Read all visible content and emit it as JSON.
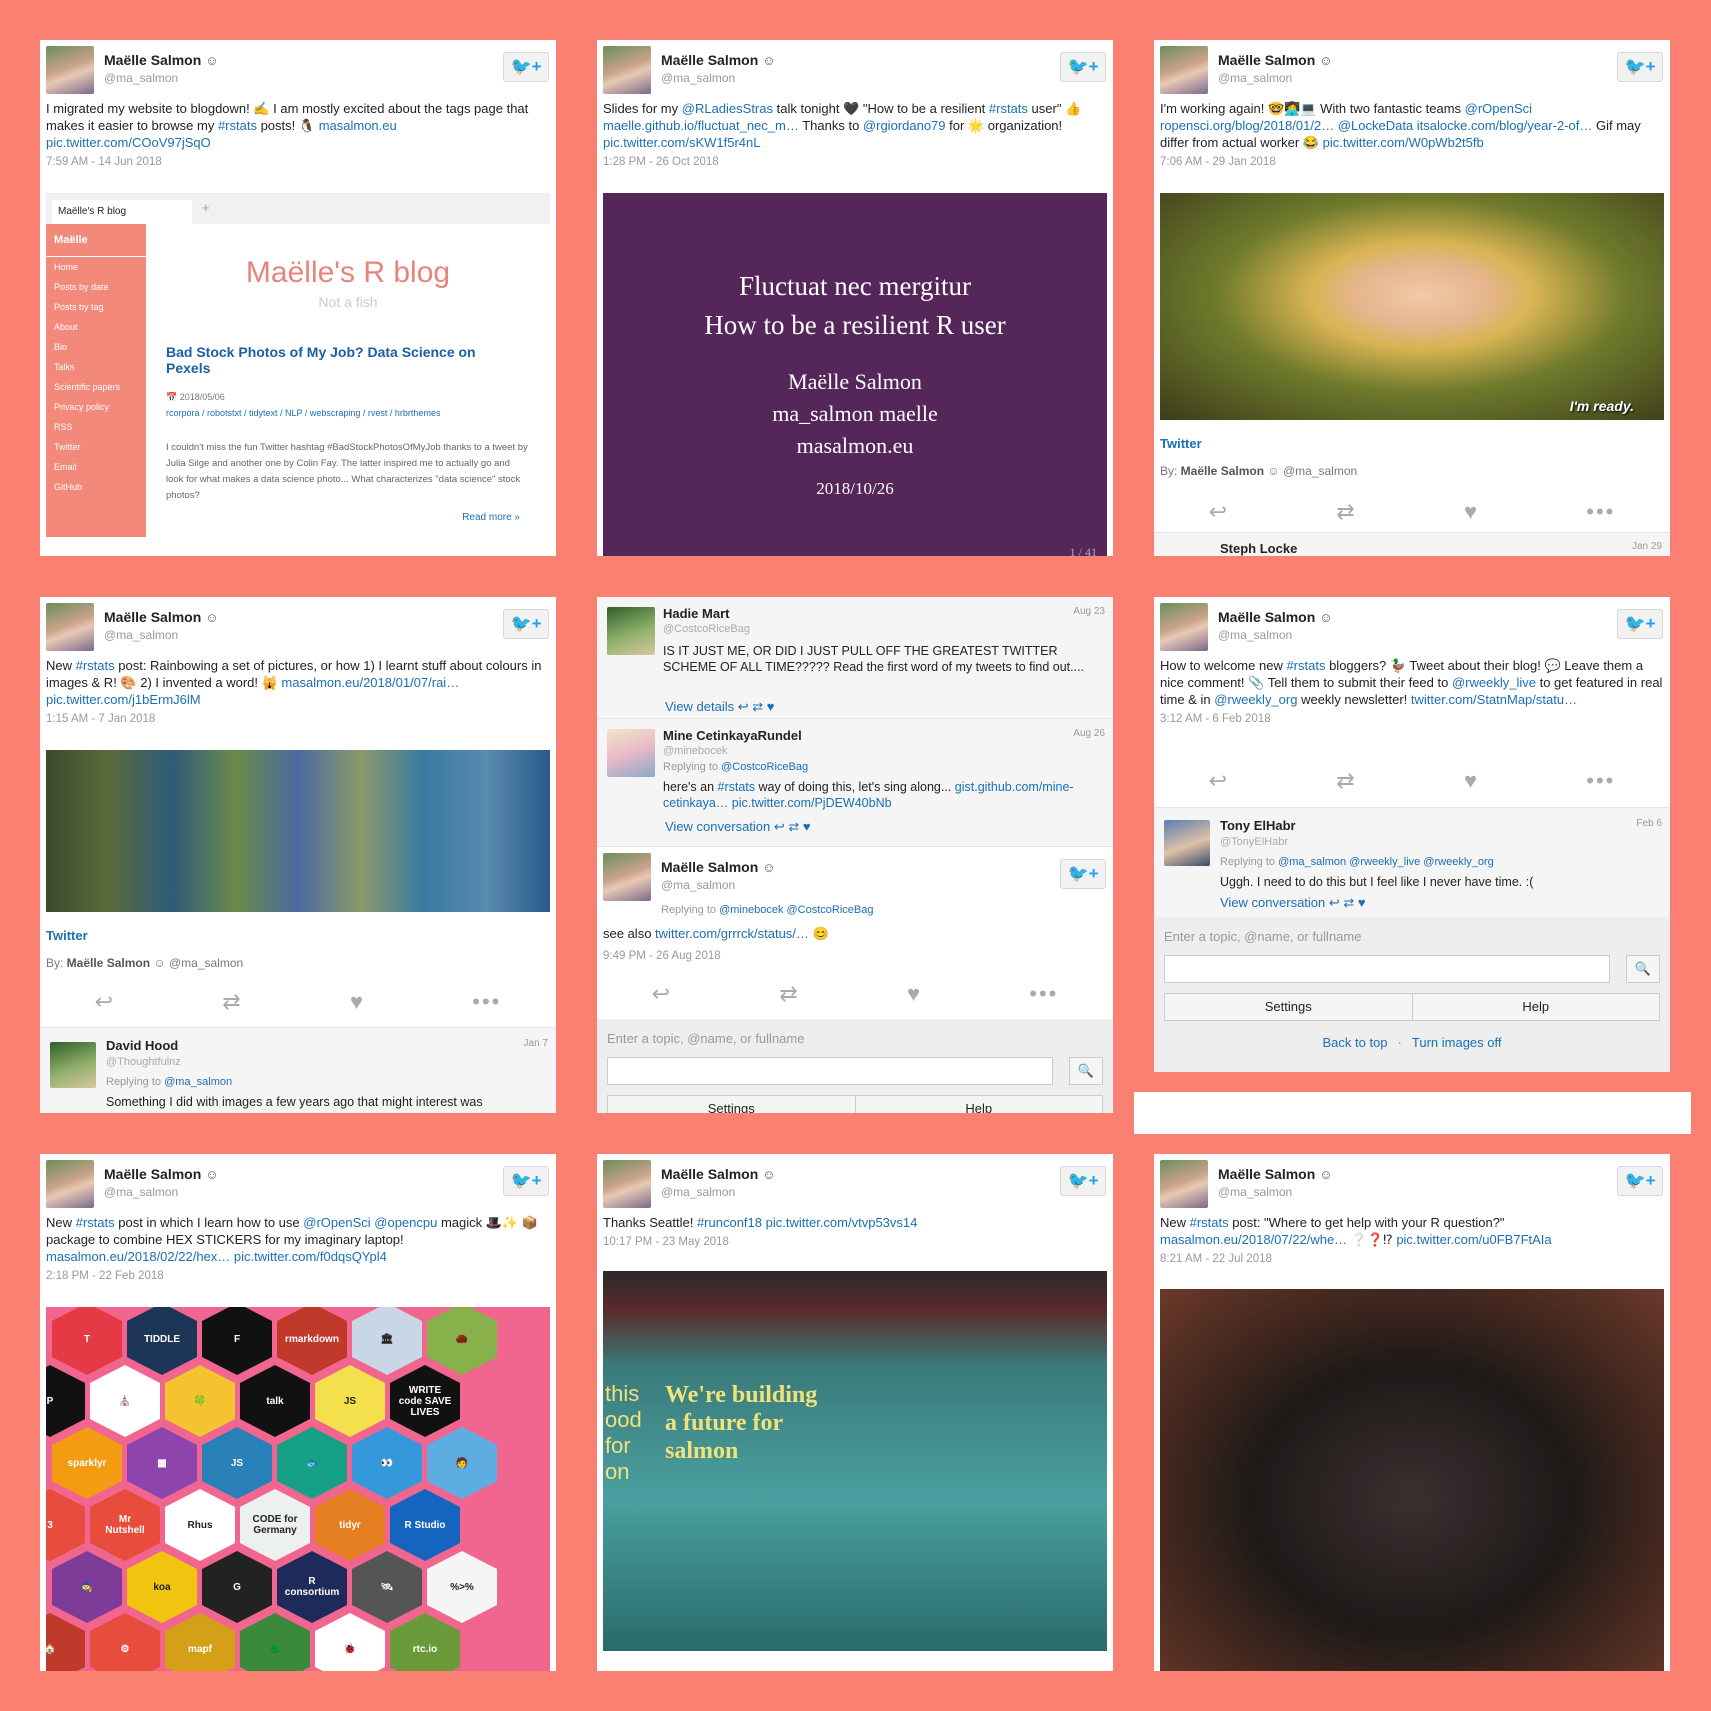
{
  "author": {
    "name": "Maëlle Salmon",
    "handle": "@ma_salmon",
    "verified_icon": "☺"
  },
  "follow_label": "+",
  "twitter_label": "Twitter",
  "by_label": "By:",
  "tweets": [
    {
      "text_parts": [
        "I migrated my website to blogdown! ✍ I am mostly excited about the tags page that makes it easier to browse my ",
        "#rstats",
        " posts! 🐧 ",
        "masalmon.eu",
        " ",
        "pic.twitter.com/COoV97jSqO"
      ],
      "date": "7:59 AM - 14 Jun 2018",
      "blog": {
        "tab": "Maëlle's R blog",
        "site": "Maëlle",
        "nav": [
          "Home",
          "Posts by date",
          "Posts by tag",
          "About",
          "Bio",
          "Talks",
          "Scientific papers",
          "Privacy policy",
          "RSS",
          "Twitter",
          "Email",
          "GitHub"
        ],
        "title": "Maëlle's R blog",
        "subtitle": "Not a fish",
        "post_title": "Bad Stock Photos of My Job? Data Science on Pexels",
        "post_date": "2018/05/06",
        "tags": "rcorpora / robotstxt / tidytext / NLP / webscraping / rvest / hrbrthemes",
        "excerpt": "I couldn't miss the fun Twitter hashtag #BadStockPhotosOfMyJob thanks to a tweet by Julia Silge and another one by Colin Fay. The latter inspired me to actually go and look for what makes a data science photo... What characterizes \"data science\" stock photos?",
        "more": "Read more »"
      }
    },
    {
      "text_parts": [
        "Slides for my ",
        "@RLadiesStras",
        " talk tonight 🖤 \"How to be a resilient ",
        "#rstats",
        " user\" 👍 ",
        "maelle.github.io/fluctuat_nec_m…",
        " Thanks to ",
        "@rgiordano79",
        " for 🌟 organization! ",
        "pic.twitter.com/sKW1f5r4nL"
      ],
      "date": "1:28 PM - 26 Oct 2018",
      "slide": {
        "line1": "Fluctuat nec mergitur",
        "line2": "How to be a resilient R user",
        "author": "Maëlle Salmon",
        "social": "ma_salmon  maelle",
        "site": "masalmon.eu",
        "date": "2018/10/26",
        "page": "1 / 41"
      }
    },
    {
      "text_parts": [
        "I'm working again! 🤓👩‍💻💻 With two fantastic teams ",
        "@rOpenSci",
        " ",
        "ropensci.org/blog/2018/01/2…",
        " ",
        "@LockeData",
        " ",
        "itsalocke.com/blog/year-2-of…",
        " Gif may differ from actual worker 😂 ",
        "pic.twitter.com/W0pWb2t5fb"
      ],
      "date": "7:06 AM - 29 Jan 2018",
      "caption": "I'm ready.",
      "reply_name": "Steph Locke",
      "reply_date": "Jan 29"
    },
    {
      "text_parts": [
        "New ",
        "#rstats",
        " post: Rainbowing a set of pictures, or how 1) I learnt stuff about colours in images & R! 🎨 2) I invented a word! 🙀 ",
        "masalmon.eu/2018/01/07/rai…",
        " ",
        "pic.twitter.com/j1bErmJ6lM"
      ],
      "date": "1:15 AM - 7 Jan 2018",
      "reply": {
        "name": "David Hood",
        "handle": "@Thoughtfulnz",
        "date": "Jan 7",
        "to": "@ma_salmon",
        "text": "Something I did with images a few years ago that might interest was"
      }
    },
    {
      "thread": [
        {
          "name": "Hadie Mart",
          "handle": "@CostcoRiceBag",
          "date": "Aug 23",
          "text": "IS IT JUST ME, OR DID I JUST PULL OFF THE GREATEST TWITTER SCHEME OF ALL TIME????? Read the first word of my tweets to find out....",
          "link": "View details"
        },
        {
          "name": "Mine CetinkayaRundel",
          "handle": "@minebocek",
          "date": "Aug 26",
          "to": "@CostcoRiceBag",
          "text_parts": [
            "here's an ",
            "#rstats",
            " way of doing this, let's sing along... ",
            "gist.github.com/mine-cetinkaya…",
            " ",
            "pic.twitter.com/PjDEW40bNb"
          ],
          "link": "View conversation"
        }
      ],
      "replying": "Replying to",
      "reply_to": "@minebocek @CostcoRiceBag",
      "text_parts": [
        "see also ",
        "twitter.com/grrrck/status/…",
        " 😊"
      ],
      "date": "9:49 PM - 26 Aug 2018"
    },
    {
      "text_parts": [
        "How to welcome new ",
        "#rstats",
        " bloggers? 🦆 Tweet about their blog! 💬 Leave them a nice comment! 📎 Tell them to submit their feed to ",
        "@rweekly_live",
        " to get featured in real time & in ",
        "@rweekly_org",
        " weekly newsletter! ",
        "twitter.com/StatnMap/statu…"
      ],
      "date": "3:12 AM - 6 Feb 2018",
      "reply": {
        "name": "Tony ElHabr",
        "handle": "@TonyElHabr",
        "date": "Feb 6",
        "to": "@ma_salmon @rweekly_live @rweekly_org",
        "text": "Uggh. I need to do this but I feel like I never have time. :(",
        "link": "View conversation"
      }
    },
    {
      "text_parts": [
        "New ",
        "#rstats",
        " post in which I learn how to use ",
        "@rOpenSci",
        " ",
        "@opencpu",
        " magick 🎩✨ 📦 package to combine HEX STICKERS for my imaginary laptop! ",
        "masalmon.eu/2018/02/22/hex…",
        " ",
        "pic.twitter.com/f0dqsQYpl4"
      ],
      "date": "2:18 PM - 22 Feb 2018",
      "hexes": [
        "T",
        "TIDDLE",
        "F",
        "rmarkdown",
        "🏛",
        "🌰",
        "P",
        "⛪",
        "🍀",
        "talk",
        "JS",
        "WRITE code SAVE LIVES",
        "sparklyr",
        "▦",
        "JS",
        "🐟",
        "👀",
        "🧑",
        "3",
        "Mr Nutshell",
        "Rhus",
        "CODE for Germany",
        "tidyr",
        "R Studio",
        "🧙",
        "koa",
        "G",
        "R consortium",
        "🛰",
        "%>%",
        "🏠",
        "⚙",
        "mapf",
        "🌲",
        "🐞",
        "rtc.io"
      ]
    },
    {
      "text_parts": [
        "Thanks Seattle! ",
        "#runconf18",
        " ",
        "pic.twitter.com/vtvp53vs14"
      ],
      "date": "10:17 PM - 23 May 2018",
      "banner": "We're building a future for salmon",
      "banner_left": "this\nood\nfor\non"
    },
    {
      "text_parts": [
        "New ",
        "#rstats",
        " post: \"Where to get help with your R question?\" ",
        "masalmon.eu/2018/07/22/whe…",
        " ❔❓⁉ ",
        "pic.twitter.com/u0FB7FtAIa"
      ],
      "date": "8:21 AM - 22 Jul 2018"
    }
  ],
  "search": {
    "placeholder": "Enter a topic, @name, or fullname",
    "settings": "Settings",
    "help": "Help",
    "back_to_top": "Back to top",
    "images_off": "Turn images off",
    "sep": "·"
  }
}
